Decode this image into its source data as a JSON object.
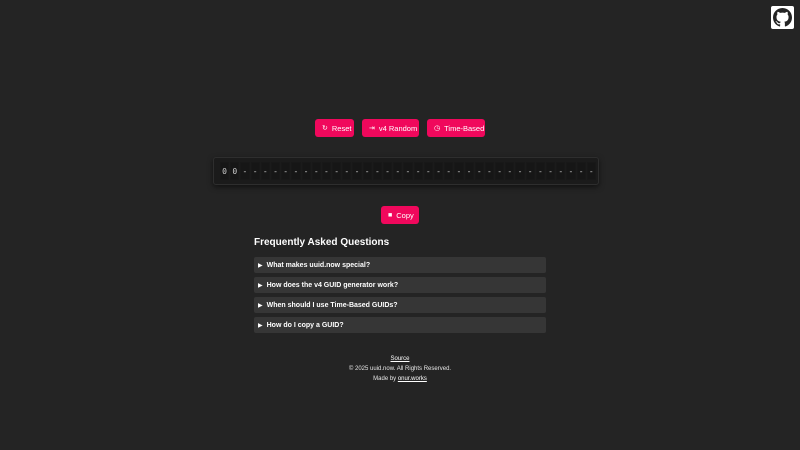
{
  "header": {
    "github_icon": "github-icon"
  },
  "controls": {
    "reset_icon": "↻",
    "reset_label": "Reset",
    "v4_icon": "⇥",
    "v4_label": "v4 Random",
    "time_icon": "◷",
    "time_label": "Time-Based"
  },
  "guid": {
    "chars": [
      "0",
      "0",
      "-",
      "-",
      "-",
      "-",
      "-",
      "-",
      "-",
      "-",
      "-",
      "-",
      "-",
      "-",
      "-",
      "-",
      "-",
      "-",
      "-",
      "-",
      "-",
      "-",
      "-",
      "-",
      "-",
      "-",
      "-",
      "-",
      "-",
      "-",
      "-",
      "-",
      "-",
      "-",
      "-",
      "-",
      "-"
    ]
  },
  "copy": {
    "icon": "■",
    "label": "Copy"
  },
  "faq": {
    "title": "Frequently Asked Questions",
    "items": [
      {
        "question": "What makes uuid.now special?"
      },
      {
        "question": "How does the v4 GUID generator work?"
      },
      {
        "question": "When should I use Time-Based GUIDs?"
      },
      {
        "question": "How do I copy a GUID?"
      }
    ]
  },
  "footer": {
    "source_label": "Source",
    "copyright": "© 2025 uuid.now. All Rights Reserved.",
    "made_by_prefix": "Made by ",
    "made_by_link": "onur.works"
  },
  "colors": {
    "background": "#242424",
    "accent": "#f0085c",
    "faq_item_bg": "#363636",
    "guid_box_bg": "#1b1b1b"
  }
}
